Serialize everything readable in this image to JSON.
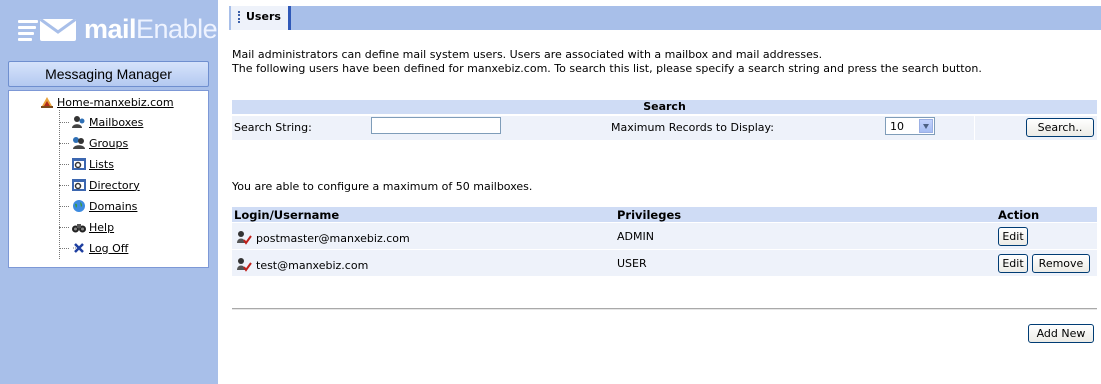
{
  "sidebar": {
    "logo": {
      "bold": "mail",
      "thin": "Enable"
    },
    "messaging_manager": "Messaging Manager",
    "tree": {
      "root": "Home-manxebiz.com",
      "items": [
        {
          "label": "Mailboxes",
          "icon": "mailbox-icon"
        },
        {
          "label": "Groups",
          "icon": "groups-icon"
        },
        {
          "label": "Lists",
          "icon": "lists-icon"
        },
        {
          "label": "Directory",
          "icon": "directory-icon"
        },
        {
          "label": "Domains",
          "icon": "domains-icon"
        },
        {
          "label": "Help",
          "icon": "help-binoculars-icon"
        },
        {
          "label": "Log Off",
          "icon": "logoff-icon"
        }
      ]
    }
  },
  "header": {
    "tab": "Users"
  },
  "main": {
    "description_line1": "Mail administrators can define mail system users. Users are associated with a mailbox and mail addresses.",
    "description_line2": "The following users have been defined for manxebiz.com. To search this list, please specify a search string and press the search button.",
    "search": {
      "title": "Search",
      "string_label": "Search String:",
      "string_value": "",
      "max_label": "Maximum Records to Display:",
      "max_value": "10",
      "button": "Search.."
    },
    "max_note": "You are able to configure a maximum of 50 mailboxes.",
    "table": {
      "headers": {
        "login": "Login/Username",
        "privileges": "Privileges",
        "action": "Action"
      },
      "rows": [
        {
          "login": "postmaster@manxebiz.com",
          "privileges": "ADMIN",
          "edit": "Edit"
        },
        {
          "login": "test@manxebiz.com",
          "privileges": "USER",
          "edit": "Edit",
          "remove": "Remove"
        }
      ]
    },
    "add_new": "Add New"
  },
  "colors": {
    "sidebar_bg": "#a8bfe9",
    "header_row_bg": "#cfdcf5",
    "row_bg": "#eef2fa",
    "tab_accent": "#2f58b8"
  }
}
